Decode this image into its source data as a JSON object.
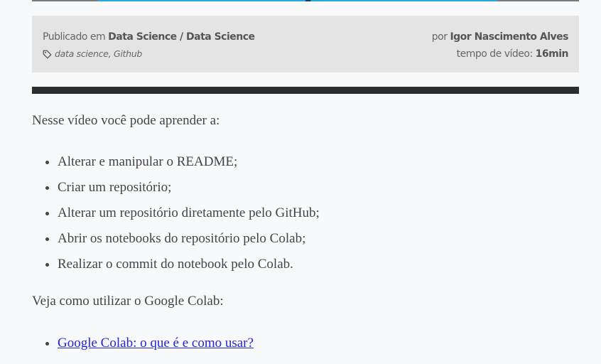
{
  "meta": {
    "published_prefix": "Publicado em",
    "category": "Data Science / Data Science",
    "tags": [
      {
        "label": "data science"
      },
      {
        "label": "Github"
      }
    ],
    "tag_separator": ", ",
    "author_prefix": "por",
    "author": "Igor Nascimento Alves",
    "duration_label": "tempo de vídeo:",
    "duration_value": "16min"
  },
  "article": {
    "intro": "Nesse vídeo você pode aprender a:",
    "learn_items": [
      {
        "text": "Alterar e manipular o README;"
      },
      {
        "text": "Criar um repositório;"
      },
      {
        "text": "Alterar um repositório diretamente pelo GitHub;"
      },
      {
        "text": "Abrir os notebooks do repositório pelo Colab;"
      },
      {
        "text": "Realizar o commit do notebook pelo Colab."
      }
    ],
    "outro": "Veja como utilizar o Google Colab:",
    "links": [
      {
        "text": "Google Colab: o que é e como usar?"
      }
    ]
  },
  "colors": {
    "meta_background": "#e4e4e4",
    "divider": "#2b2d30",
    "link": "#2323d8",
    "page_background": "#f8f9fb"
  }
}
